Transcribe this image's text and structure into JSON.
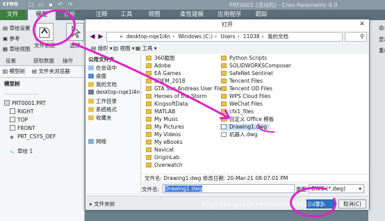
{
  "app": {
    "logo": "creo",
    "title": "PRT0001 (活动的) - Creo Parametric 6.0"
  },
  "ribbon_tabs": [
    "文件",
    "模型",
    "分析",
    "注释",
    "工具",
    "视图",
    "柔性建模",
    "应用程序",
    "跟踪"
  ],
  "ribbon": {
    "small_items": [
      "草绘设置",
      "参考",
      "草绘视图"
    ],
    "big_buttons": [
      "文件系统",
      "选择"
    ],
    "groups": [
      "设置",
      "获取数据",
      "操作"
    ]
  },
  "left_panel": {
    "tabs": [
      "模型树",
      "文件夹浏览器"
    ],
    "tree_header": "模型树",
    "tree_items": [
      "PRT0001.PRT",
      "RIGHT",
      "TOP",
      "FRONT",
      "PRT_CSYS_DEF",
      "草绘 1"
    ]
  },
  "dialog": {
    "title": "打开",
    "breadcrumb": [
      "desktop-nqe1i4n",
      "Windows (C:)",
      "Users",
      "11038",
      "我的文档"
    ],
    "toolbar": [
      "组织",
      "视图",
      "工具"
    ],
    "nav_header": "公用文件夹",
    "nav_items": [
      "在会话中",
      "桌面",
      "我的文档",
      "desktop-nqe1i4n",
      "工作目录",
      "系统格式",
      "收藏夹",
      "网络"
    ],
    "files_col1": [
      "360截图",
      "Adobe",
      "EA Games",
      "EDEM_2018",
      "GTA San Andreas User Files",
      "Heroes of the Storm",
      "KingsoftData",
      "MATLAB",
      "My Music",
      "My Pictures",
      "My Videos",
      "My eBooks",
      "Navicat",
      "OriginLab",
      "Overwatch"
    ],
    "files_col2": [
      "Python Scripts",
      "SOLIDWORKSComposer",
      "SafeNet Sentinel",
      "Tencent Files",
      "Tencent OD Files",
      "WPS Cloud Files",
      "WeChat Files",
      "cfx1_files",
      "自定义 Office 模板",
      "Drawing1.dwg",
      "机器人.dwg"
    ],
    "selected_file": "Drawing1.dwg",
    "details": "文件名: Drawing1.dwg  修改日期: 20-Mar-21 08:07:01 PM",
    "filename_label": "文件名:",
    "filename_value": "Drawing1.dwg",
    "type_label": "类型",
    "type_value": "DWG (*.dwg)",
    "folder_tree_label": "文件夹树",
    "buttons": {
      "open": "导入",
      "cancel": "取消(C)"
    }
  },
  "right_strip": [
    "命名",
    "显示",
    "重命"
  ],
  "watermark": "https://blog.csdn.net/weixin_43610411",
  "colors": {
    "file_tab": "#3e7d3b",
    "annotation": "#e020c8",
    "primary_button": "#2f73c8"
  }
}
